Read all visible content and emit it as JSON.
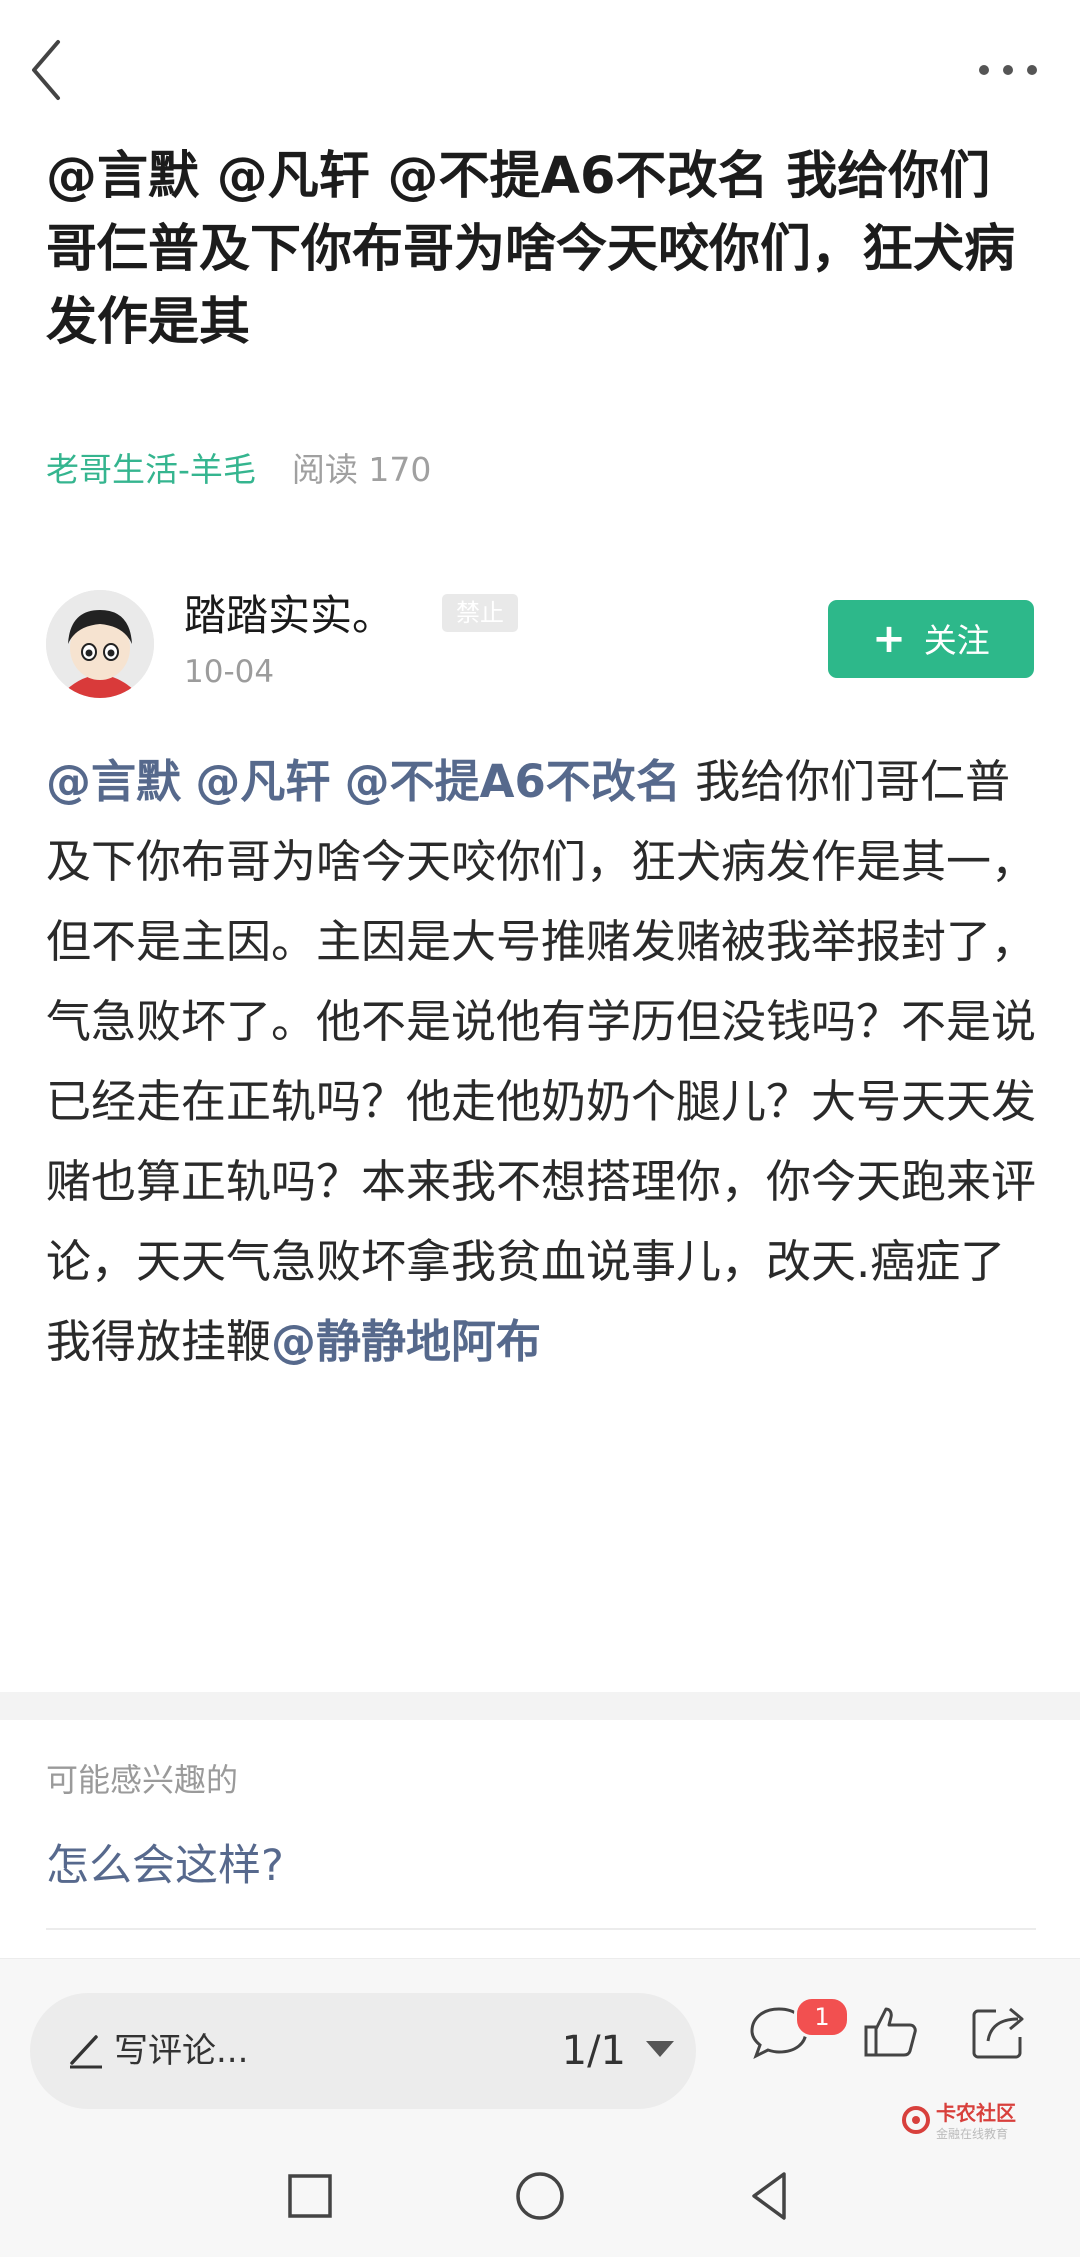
{
  "post": {
    "title": "@言默 @凡轩 @不提A6不改名 我给你们哥仨普及下你布哥为啥今天咬你们，狂犬病发作是其",
    "category": "老哥生活-羊毛",
    "reads": "阅读 170"
  },
  "author": {
    "name": "踏踏实实。",
    "badge": "禁止",
    "date": "10-04",
    "follow_label": "关注"
  },
  "content": {
    "mentions": [
      "@言默",
      "@凡轩",
      "@不提A6不改名"
    ],
    "body": " 我给你们哥仁普及下你布哥为啥今天咬你们，狂犬病发作是其一，但不是主因。主因是大号推赌发赌被我举报封了，气急败坏了。他不是说他有学历但没钱吗？不是说已经走在正轨吗？他走他奶奶个腿儿？大号天天发赌也算正轨吗？本来我不想搭理你，你今天跑来评论，天天气急败坏拿我贫血说事儿，改天.癌症了我得放挂鞭",
    "tail_mention": "@静静地阿布"
  },
  "recommend": {
    "title": "可能感兴趣的",
    "item": "怎么会这样?"
  },
  "bottom_bar": {
    "comment_placeholder": "写评论...",
    "page": "1/1",
    "comment_badge": "1"
  },
  "watermark": {
    "name": "卡农社区",
    "sub": "金融在线教育"
  },
  "colors": {
    "accent_green": "#2db88a",
    "mention_blue": "#56698c",
    "badge_red": "#f25050"
  },
  "icons": [
    "back-icon",
    "more-icon",
    "avatar",
    "plus-icon",
    "pencil-icon",
    "dropdown-icon",
    "comment-icon",
    "like-icon",
    "share-icon",
    "square-icon",
    "circle-icon",
    "triangle-back-icon"
  ]
}
